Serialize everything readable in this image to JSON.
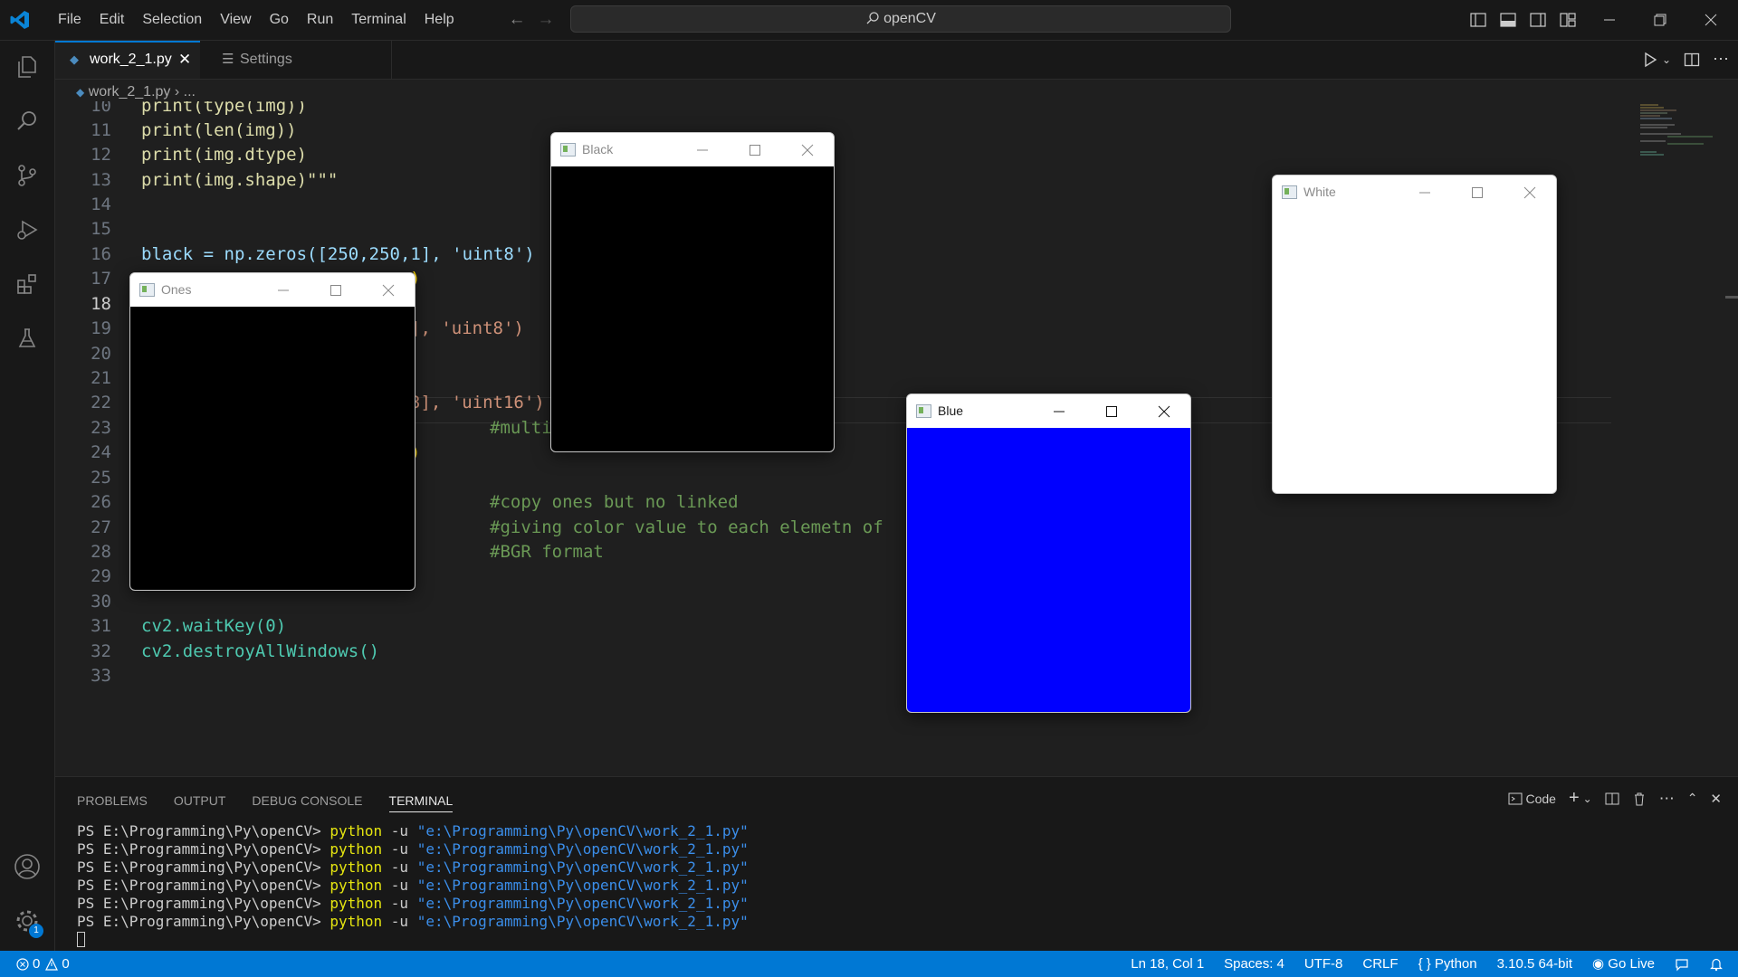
{
  "titlebar": {
    "menu": [
      "File",
      "Edit",
      "Selection",
      "View",
      "Go",
      "Run",
      "Terminal",
      "Help"
    ],
    "search": "openCV"
  },
  "tabs": [
    {
      "label": "work_2_1.py",
      "active": true
    },
    {
      "label": "Settings",
      "active": false
    }
  ],
  "breadcrumb": {
    "file": "work_2_1.py",
    "rest": "..."
  },
  "editor": {
    "current_line": 18,
    "lines": [
      {
        "n": "10",
        "text": "print(type(img))"
      },
      {
        "n": "11",
        "text": "print(len(img))"
      },
      {
        "n": "12",
        "text": "print(img.dtype)"
      },
      {
        "n": "13",
        "text": "print(img.shape)\"\"\""
      },
      {
        "n": "14",
        "text": ""
      },
      {
        "n": "15",
        "text": ""
      },
      {
        "n": "16",
        "text": "black = np.zeros([250,250,1], 'uint8')"
      },
      {
        "n": "17",
        "text": ")"
      },
      {
        "n": "18",
        "text": ""
      },
      {
        "n": "19",
        "text": "], 'uint8')"
      },
      {
        "n": "20",
        "text": ""
      },
      {
        "n": "21",
        "text": ""
      },
      {
        "n": "22",
        "text": "3], 'uint16')"
      },
      {
        "n": "23",
        "text": "#multi"
      },
      {
        "n": "24",
        "text": ")"
      },
      {
        "n": "25",
        "text": ""
      },
      {
        "n": "26",
        "text": "#copy ones but no linked"
      },
      {
        "n": "27",
        "text": "#giving color value to each elemetn of"
      },
      {
        "n": "28",
        "text": "#BGR format"
      },
      {
        "n": "29",
        "text": ""
      },
      {
        "n": "30",
        "text": ""
      },
      {
        "n": "31",
        "text": "cv2.waitKey(0)"
      },
      {
        "n": "32",
        "text": "cv2.destroyAllWindows()"
      },
      {
        "n": "33",
        "text": ""
      }
    ]
  },
  "cv_windows": [
    {
      "title": "Black",
      "fill": "#000000"
    },
    {
      "title": "White",
      "fill": "#ffffff"
    },
    {
      "title": "Ones",
      "fill": "#000000"
    },
    {
      "title": "Blue",
      "fill": "#0000ff"
    }
  ],
  "panel": {
    "tabs": [
      "PROBLEMS",
      "OUTPUT",
      "DEBUG CONSOLE",
      "TERMINAL"
    ],
    "active_tab": "TERMINAL",
    "terminal_profile": "Code",
    "terminal_lines": [
      {
        "prompt": "PS E:\\Programming\\Py\\openCV> ",
        "cmd": "python",
        "arg": " -u ",
        "path": "\"e:\\Programming\\Py\\openCV\\work_2_1.py\""
      },
      {
        "prompt": "PS E:\\Programming\\Py\\openCV> ",
        "cmd": "python",
        "arg": " -u ",
        "path": "\"e:\\Programming\\Py\\openCV\\work_2_1.py\""
      },
      {
        "prompt": "PS E:\\Programming\\Py\\openCV> ",
        "cmd": "python",
        "arg": " -u ",
        "path": "\"e:\\Programming\\Py\\openCV\\work_2_1.py\""
      },
      {
        "prompt": "PS E:\\Programming\\Py\\openCV> ",
        "cmd": "python",
        "arg": " -u ",
        "path": "\"e:\\Programming\\Py\\openCV\\work_2_1.py\""
      },
      {
        "prompt": "PS E:\\Programming\\Py\\openCV> ",
        "cmd": "python",
        "arg": " -u ",
        "path": "\"e:\\Programming\\Py\\openCV\\work_2_1.py\""
      },
      {
        "prompt": "PS E:\\Programming\\Py\\openCV> ",
        "cmd": "python",
        "arg": " -u ",
        "path": "\"e:\\Programming\\Py\\openCV\\work_2_1.py\""
      }
    ]
  },
  "statusbar": {
    "errors": "0",
    "warnings": "0",
    "position": "Ln 18, Col 1",
    "spaces": "Spaces: 4",
    "encoding": "UTF-8",
    "eol": "CRLF",
    "language": "Python",
    "interpreter": "3.10.5 64-bit",
    "golive": "Go Live",
    "settings_badge": "1"
  },
  "colors": {
    "accent": "#0078d4",
    "editor_bg": "#1f1f1f",
    "chrome_bg": "#181818"
  }
}
